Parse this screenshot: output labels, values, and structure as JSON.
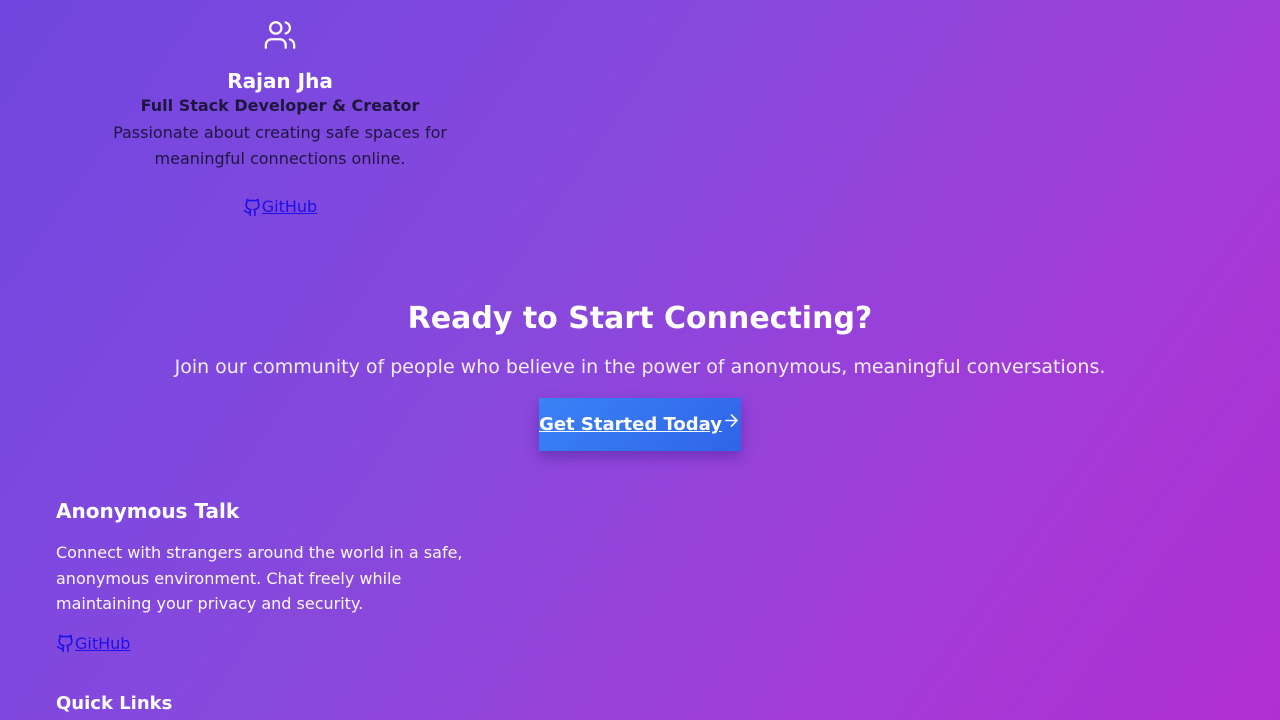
{
  "creator": {
    "icon": "users-icon",
    "name": "Rajan Jha",
    "role": "Full Stack Developer & Creator",
    "bio": "Passionate about creating safe spaces for meaningful connections online.",
    "github_label": "GitHub"
  },
  "cta": {
    "heading": "Ready to Start Connecting?",
    "subtext": "Join our community of people who believe in the power of anonymous, meaningful conversations.",
    "button_label": "Get Started Today",
    "button_icon": "arrow-right-icon"
  },
  "footer": {
    "brand": "Anonymous Talk",
    "description": "Connect with strangers around the world in a safe, anonymous environment. Chat freely while maintaining your privacy and security.",
    "github_label": "GitHub",
    "quick_links_heading": "Quick Links"
  },
  "colors": {
    "gradient_start": "#7047e0",
    "gradient_end": "#b12fd2",
    "link": "#1d10e8",
    "button_start": "#3b82f6",
    "button_end": "#2f65e8"
  }
}
